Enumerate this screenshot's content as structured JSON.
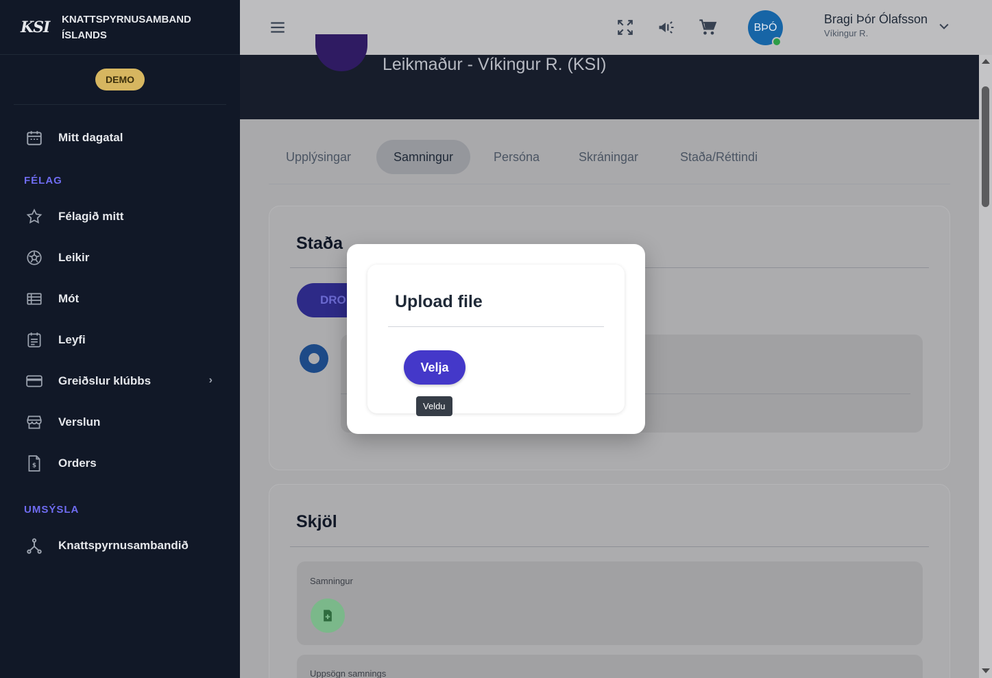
{
  "brand": {
    "logo": "KSI",
    "name_line1": "KNATTSPYRNUSAMBAND",
    "name_line2": "ÍSLANDS",
    "badge": "DEMO"
  },
  "sidebar": {
    "items": [
      {
        "label": "Mitt dagatal",
        "icon": "calendar-icon"
      },
      {
        "label": "Félagið mitt",
        "icon": "star-icon"
      },
      {
        "label": "Leikir",
        "icon": "soccer-ball-icon"
      },
      {
        "label": "Mót",
        "icon": "list-icon"
      },
      {
        "label": "Leyfi",
        "icon": "license-icon"
      },
      {
        "label": "Greiðslur klúbbs",
        "icon": "credit-card-icon"
      },
      {
        "label": "Verslun",
        "icon": "store-icon"
      },
      {
        "label": "Orders",
        "icon": "invoice-icon"
      },
      {
        "label": "Knattspyrnusambandið",
        "icon": "hierarchy-icon"
      }
    ],
    "sections": {
      "club": "FÉLAG",
      "admin": "UMSÝSLA"
    }
  },
  "topbar": {
    "avatar_initials": "BÞÓ",
    "user_name": "Bragi Þór Ólafsson",
    "user_club": "Víkingur R."
  },
  "hero": {
    "title": "Leikmaður - Víkingur R. (KSI)"
  },
  "tabs": [
    {
      "label": "Upplýsingar",
      "active": false
    },
    {
      "label": "Samningur",
      "active": true
    },
    {
      "label": "Persóna",
      "active": false
    },
    {
      "label": "Skráningar",
      "active": false
    },
    {
      "label": "Staða/Réttindi",
      "active": false
    }
  ],
  "status_card": {
    "title": "Staða",
    "draft_button": "DRO"
  },
  "documents_card": {
    "title": "Skjöl",
    "doc1_label": "Samningur",
    "doc2_label": "Uppsögn samnings"
  },
  "modal": {
    "title": "Upload file",
    "choose_button": "Velja",
    "tooltip": "Veldu"
  },
  "colors": {
    "accent": "#4438c9",
    "sidebar_bg": "#111827",
    "section_label": "#6f6cf1",
    "demo_badge": "#d6b660"
  }
}
